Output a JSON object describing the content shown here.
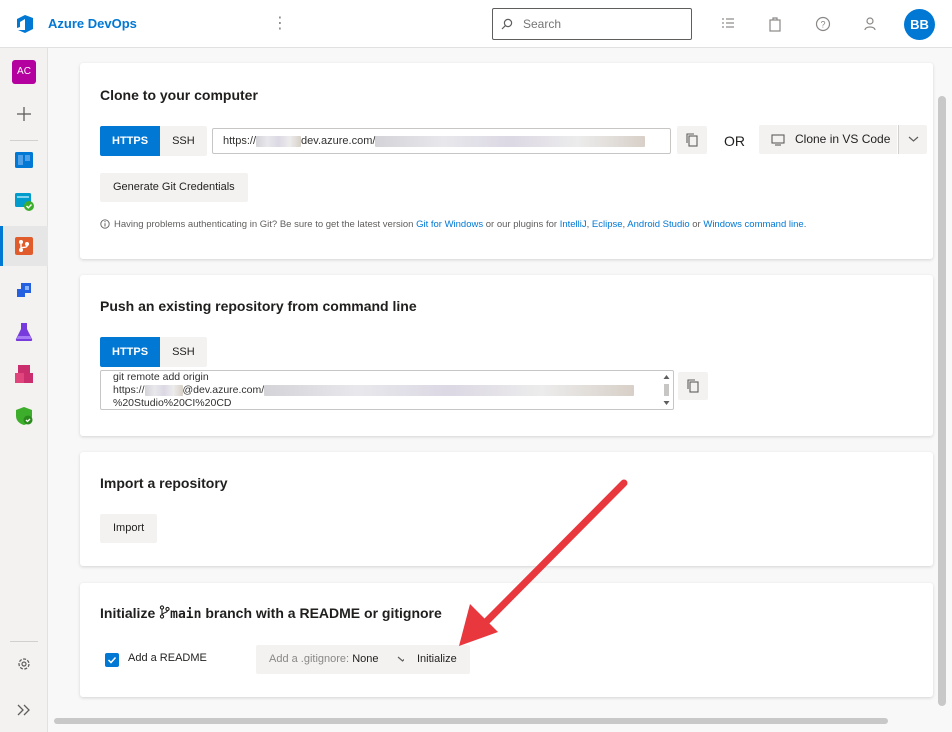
{
  "header": {
    "brand_name": "Azure DevOps",
    "search_placeholder": "Search",
    "user_initials": "BB"
  },
  "sidebar": {
    "project_initials": "AC",
    "items": [
      {
        "name": "add",
        "icon": "plus-icon"
      },
      {
        "name": "boards",
        "icon": "boards-icon"
      },
      {
        "name": "pipelines-checked",
        "icon": "board-check-icon"
      },
      {
        "name": "repos",
        "icon": "repos-icon",
        "active": true
      },
      {
        "name": "pipelines",
        "icon": "pipelines-icon"
      },
      {
        "name": "test-plans",
        "icon": "flask-icon"
      },
      {
        "name": "artifacts",
        "icon": "artifacts-icon"
      },
      {
        "name": "security",
        "icon": "shield-icon"
      }
    ],
    "settings_icon": "gear-icon",
    "collapse_icon": "double-chevron-icon"
  },
  "clone": {
    "title": "Clone to your computer",
    "https_label": "HTTPS",
    "ssh_label": "SSH",
    "url_prefix": "https://",
    "url_mid": "dev.azure.com/",
    "or_label": "OR",
    "clone_vs_label": "Clone in VS Code",
    "generate_label": "Generate Git Credentials",
    "help_text": "Having problems authenticating in Git? Be sure to get the latest version",
    "help_link_git": "Git for Windows",
    "help_text2": "or our plugins for",
    "help_link_intellij": "IntelliJ",
    "help_link_eclipse": "Eclipse",
    "help_link_android": "Android Studio",
    "help_text3": "or",
    "help_link_cmd": "Windows command line"
  },
  "push": {
    "title": "Push an existing repository from command line",
    "https_label": "HTTPS",
    "ssh_label": "SSH",
    "line1": "git remote add origin",
    "line2_prefix": "https://",
    "line2_mid": "@dev.azure.com/",
    "line3": "%20Studio%20CI%20CD"
  },
  "import": {
    "title": "Import a repository",
    "button_label": "Import"
  },
  "initialize": {
    "title_prefix": "Initialize",
    "branch_name": "main",
    "title_suffix": "branch with a README or gitignore",
    "readme_label": "Add a README",
    "readme_checked": true,
    "gitignore_label": "Add a .gitignore:",
    "gitignore_value": "None",
    "initialize_label": "Initialize"
  },
  "colors": {
    "accent": "#0078d4",
    "arrow": "#e8383d",
    "project_avatar": "#b4009e"
  }
}
